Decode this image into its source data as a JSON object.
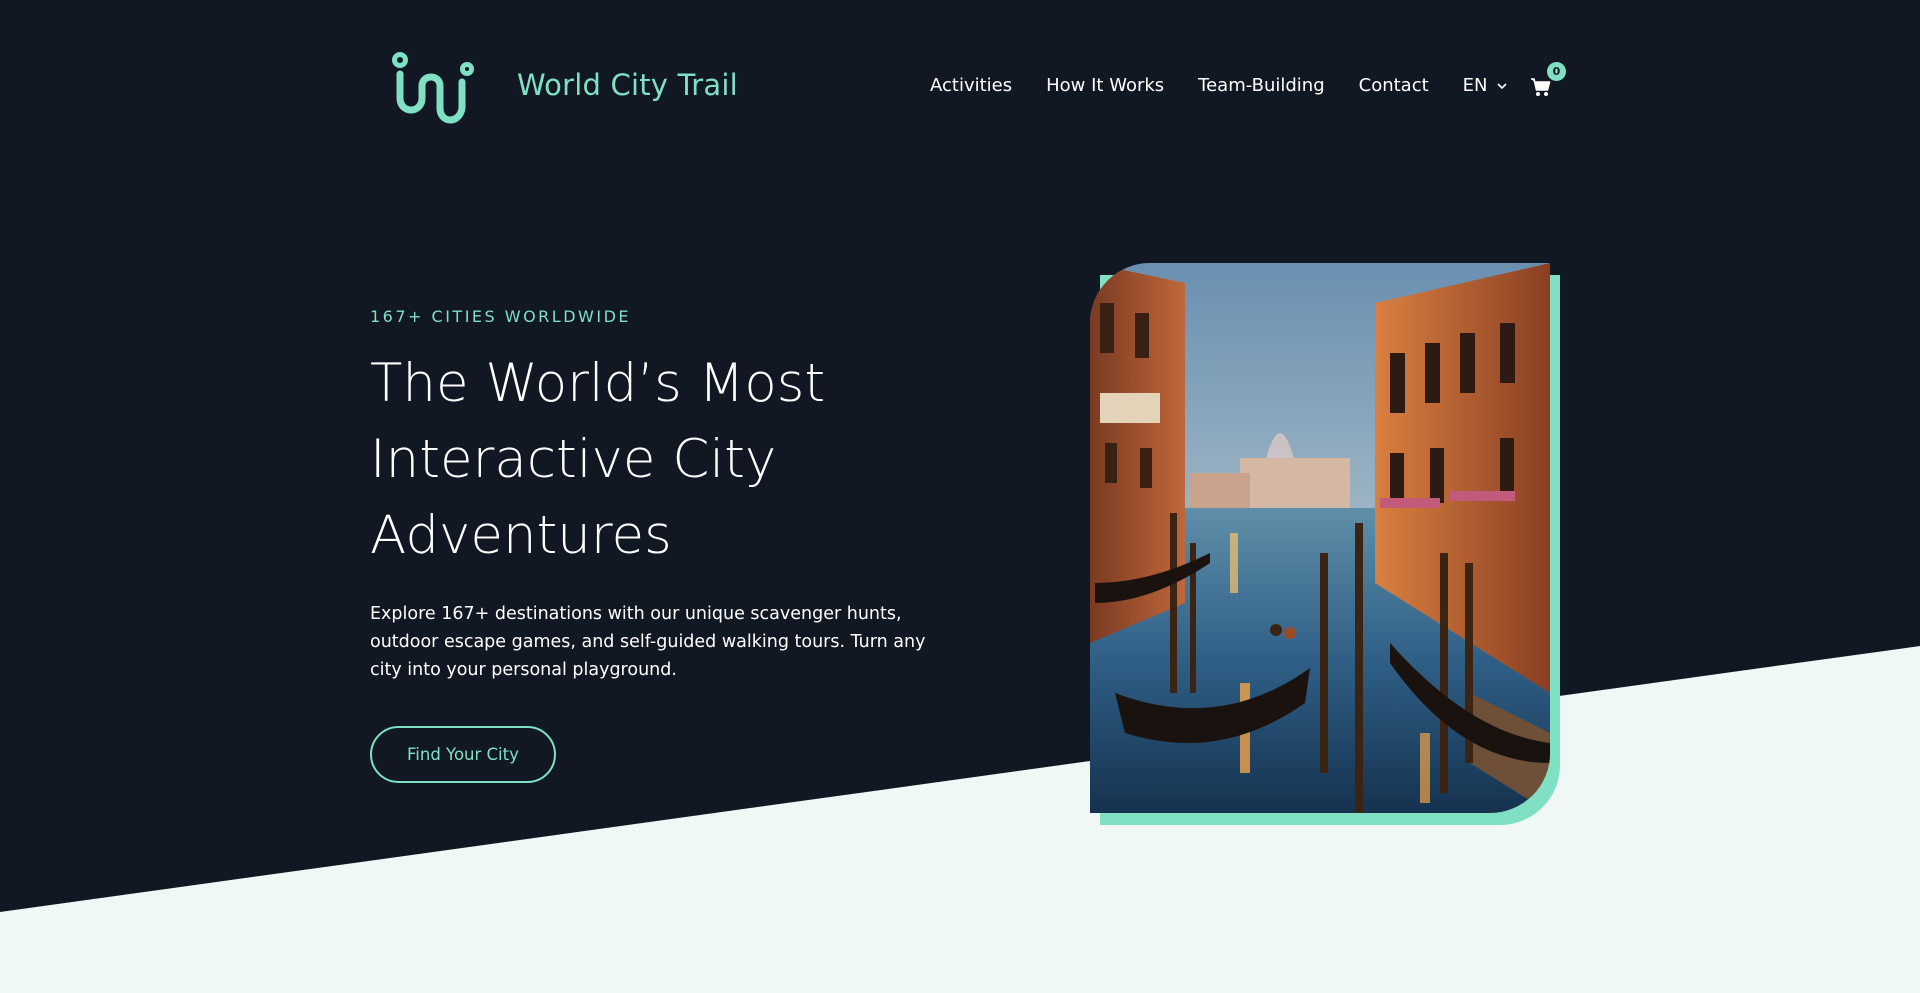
{
  "brand": {
    "name": "World City Trail",
    "logo_icon": "wct-squiggle-logo"
  },
  "nav": {
    "items": [
      {
        "label": "Activities"
      },
      {
        "label": "How It Works"
      },
      {
        "label": "Team-Building"
      },
      {
        "label": "Contact"
      }
    ],
    "language": "EN",
    "cart_count": "0"
  },
  "hero": {
    "eyebrow": "167+ CITIES WORLDWIDE",
    "title": "The World’s Most Interactive City Adventures",
    "description": "Explore 167+ destinations with our unique scavenger hunts, outdoor escape games, and self-guided walking tours. Turn any city into your personal playground.",
    "cta": "Find Your City",
    "image": "venice-canal-gondolas-painting"
  },
  "colors": {
    "background": "#111824",
    "accent": "#7fe0c4",
    "light_wedge": "#eff8f4"
  }
}
